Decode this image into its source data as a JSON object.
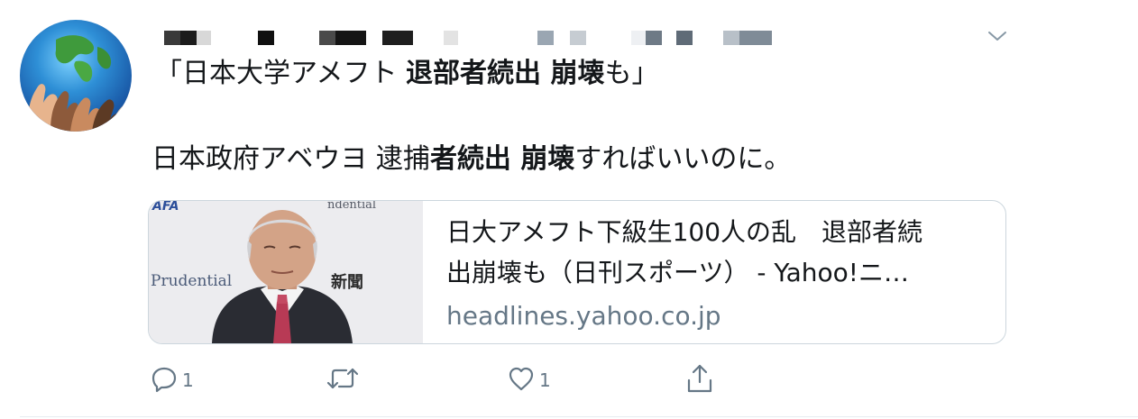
{
  "tweet": {
    "quote_title": {
      "prefix": "「日本大学アメフト ",
      "bold": "退部者続出 崩壊",
      "suffix": "も」"
    },
    "body": {
      "part1": "日本政府アベウヨ 逮捕",
      "bold": "者続出 崩壊",
      "part2": "すればいいのに。"
    },
    "card": {
      "title_line1": "日大アメフト下級生100人の乱　退部者続",
      "title_line2": "出崩壊も（日刊スポーツ） - Yahoo!ニ…",
      "domain": "headlines.yahoo.co.jp",
      "thumb_text_left": "Prudential",
      "thumb_text_top": "ndential",
      "thumb_text_logo": "AFA",
      "thumb_text_kanji": "新聞"
    },
    "actions": {
      "reply_count": "1",
      "retweet_count": "",
      "like_count": "1"
    }
  },
  "icons": {
    "reply": "reply-icon",
    "retweet": "retweet-icon",
    "like": "heart-icon",
    "share": "share-icon",
    "caret": "chevron-down-icon"
  },
  "colors": {
    "text": "#14171a",
    "secondary": "#657786",
    "border": "#ccd6dd"
  }
}
